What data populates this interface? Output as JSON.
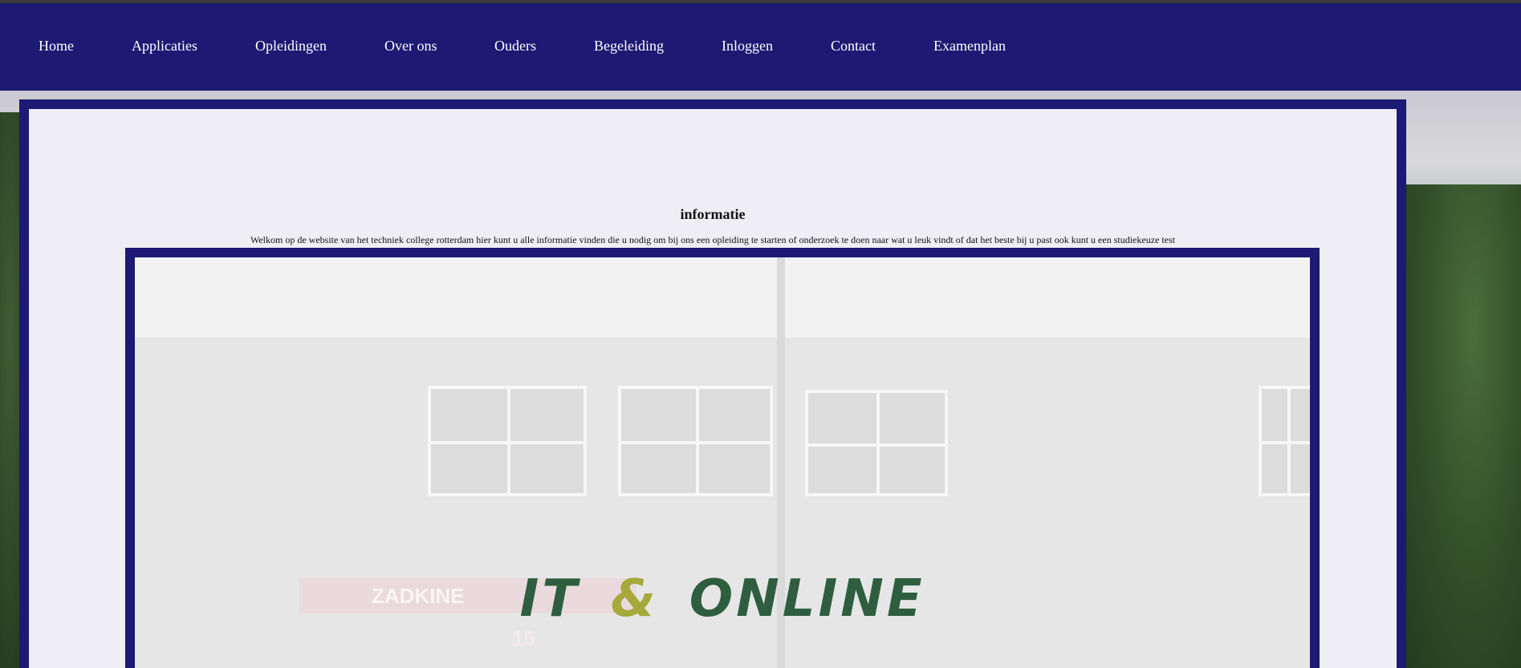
{
  "nav": {
    "items": [
      {
        "label": "Home"
      },
      {
        "label": "Applicaties"
      },
      {
        "label": "Opleidingen"
      },
      {
        "label": "Over ons"
      },
      {
        "label": "Ouders"
      },
      {
        "label": "Begeleiding"
      },
      {
        "label": "Inloggen"
      },
      {
        "label": "Contact"
      },
      {
        "label": "Examenplan"
      }
    ]
  },
  "main": {
    "heading": "informatie",
    "welcome_text": "Welkom op de website van het techniek college rotterdam hier kunt u alle informatie vinden die u nodig om bij ons een opleiding te starten of onderzoek te doen naar wat u leuk vindt of dat het beste bij u past ook kunt u een studiekeuze test"
  },
  "banner": {
    "part1": "IT",
    "ampersand": "&",
    "part2": "ONLINE",
    "photo_sign": "ZADKINE",
    "photo_number": "15"
  },
  "colors": {
    "nav_bg": "#1c1a73",
    "brand_green": "#2e5e3f",
    "brand_amp": "#a6a93b"
  }
}
